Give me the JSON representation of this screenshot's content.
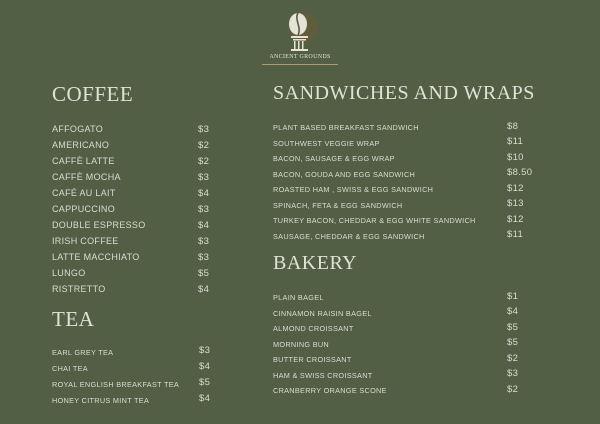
{
  "brand": {
    "name": "ANCIENT GROUNDS",
    "colors": {
      "background": "#525f45",
      "accent": "#b39a6a",
      "text": "#d9ddd0"
    },
    "logo_icon": "coffee-bean-column-icon"
  },
  "coffee": {
    "title": "COFFEE",
    "items": [
      {
        "name": "AFFOGATO",
        "price": "$3"
      },
      {
        "name": "AMERICANO",
        "price": "$2"
      },
      {
        "name": "CAFFÈ LATTE",
        "price": "$2"
      },
      {
        "name": "CAFFÈ MOCHA",
        "price": "$3"
      },
      {
        "name": "CAFÉ AU LAIT",
        "price": "$4"
      },
      {
        "name": "CAPPUCCINO",
        "price": "$3"
      },
      {
        "name": "DOUBLE ESPRESSO",
        "price": "$4"
      },
      {
        "name": "IRISH COFFEE",
        "price": "$3"
      },
      {
        "name": "LATTE MACCHIATO",
        "price": "$3"
      },
      {
        "name": "LUNGO",
        "price": "$5"
      },
      {
        "name": "RISTRETTO",
        "price": "$4"
      }
    ]
  },
  "tea": {
    "title": "TEA",
    "items": [
      {
        "name": "EARL GREY TEA",
        "price": "$3"
      },
      {
        "name": "CHAI TEA",
        "price": "$4"
      },
      {
        "name": "ROYAL ENGLISH BREAKFAST TEA",
        "price": "$5"
      },
      {
        "name": "HONEY CITRUS MINT TEA",
        "price": "$4"
      }
    ]
  },
  "sandwiches": {
    "title": "SANDWICHES AND WRAPS",
    "items": [
      {
        "name": "PLANT BASED BREAKFAST SANDWICH",
        "price": "$8"
      },
      {
        "name": "SOUTHWEST VEGGIE WRAP",
        "price": "$11"
      },
      {
        "name": "BACON, SAUSAGE & EGG WRAP",
        "price": "$10"
      },
      {
        "name": "BACON, GOUDA AND EGG SANDWICH",
        "price": "$8.50"
      },
      {
        "name": "ROASTED HAM , SWISS & EGG SANDWICH",
        "price": "$12"
      },
      {
        "name": "SPINACH, FETA & EGG SANDWICH",
        "price": "$13"
      },
      {
        "name": "TURKEY BACON, CHEDDAR & EGG WHITE SANDWICH",
        "price": "$12"
      },
      {
        "name": "SAUSAGE, CHEDDAR & EGG SANDWICH",
        "price": "$11"
      }
    ]
  },
  "bakery": {
    "title": "BAKERY",
    "items": [
      {
        "name": "PLAIN BAGEL",
        "price": "$1"
      },
      {
        "name": "CINNAMON RAISIN BAGEL",
        "price": "$4"
      },
      {
        "name": "ALMOND CROISSANT",
        "price": "$5"
      },
      {
        "name": "MORNING BUN",
        "price": "$5"
      },
      {
        "name": "BUTTER CROISSANT",
        "price": "$2"
      },
      {
        "name": "HAM & SWISS CROISSANT",
        "price": "$3"
      },
      {
        "name": "CRANBERRY ORANGE SCONE",
        "price": "$2"
      }
    ]
  }
}
